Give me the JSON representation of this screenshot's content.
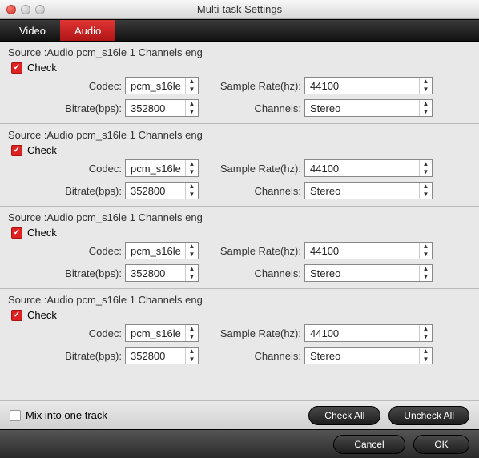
{
  "window": {
    "title": "Multi-task Settings"
  },
  "tabs": {
    "video": "Video",
    "audio": "Audio"
  },
  "labels": {
    "codec": "Codec:",
    "bitrate": "Bitrate(bps):",
    "sampleRate": "Sample Rate(hz):",
    "channels": "Channels:",
    "check": "Check"
  },
  "tracks": [
    {
      "source": "Source :Audio  pcm_s16le  1 Channels  eng",
      "checked": true,
      "codec": "pcm_s16le",
      "bitrate": "352800",
      "sampleRate": "44100",
      "channels": "Stereo"
    },
    {
      "source": "Source :Audio  pcm_s16le  1 Channels  eng",
      "checked": true,
      "codec": "pcm_s16le",
      "bitrate": "352800",
      "sampleRate": "44100",
      "channels": "Stereo"
    },
    {
      "source": "Source :Audio  pcm_s16le  1 Channels  eng",
      "checked": true,
      "codec": "pcm_s16le",
      "bitrate": "352800",
      "sampleRate": "44100",
      "channels": "Stereo"
    },
    {
      "source": "Source :Audio  pcm_s16le  1 Channels  eng",
      "checked": true,
      "codec": "pcm_s16le",
      "bitrate": "352800",
      "sampleRate": "44100",
      "channels": "Stereo"
    }
  ],
  "footer": {
    "mix": "Mix into one track",
    "checkAll": "Check All",
    "uncheckAll": "Uncheck All",
    "cancel": "Cancel",
    "ok": "OK"
  }
}
